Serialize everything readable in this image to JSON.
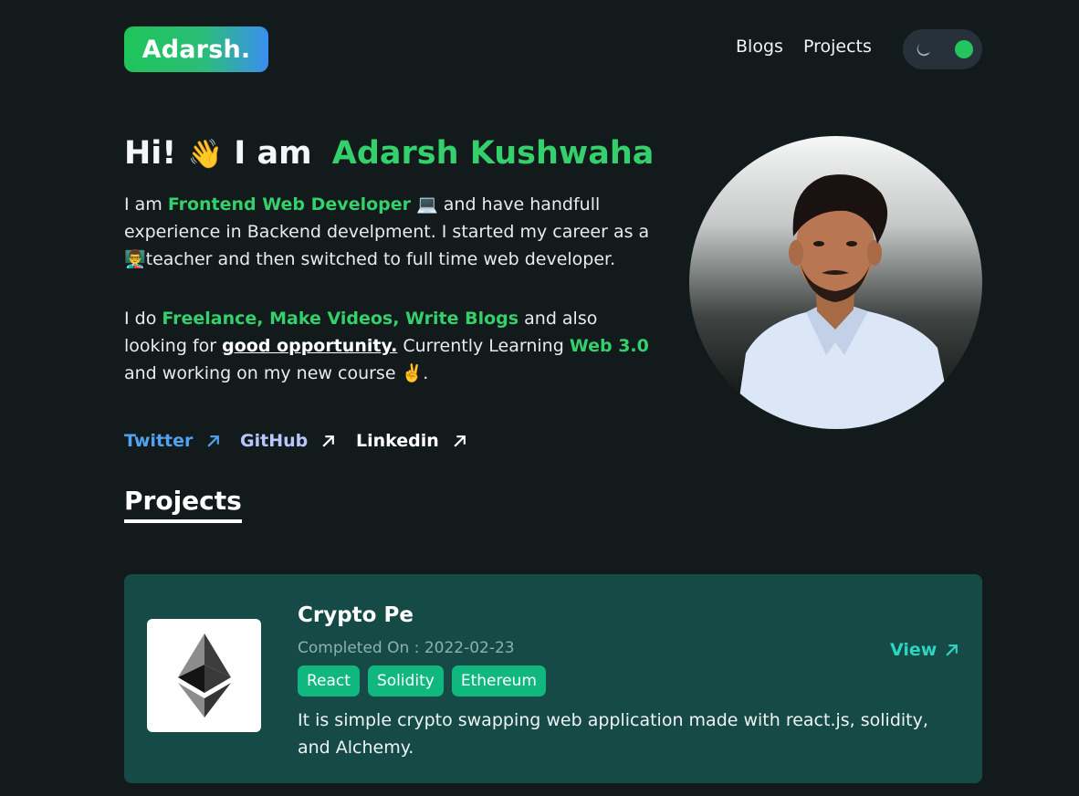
{
  "header": {
    "logo": "Adarsh.",
    "nav": {
      "blogs": "Blogs",
      "projects": "Projects"
    },
    "theme_toggle": {
      "icon": "moon-icon",
      "state_color": "#22c55e"
    }
  },
  "hero": {
    "greeting": "Hi!",
    "wave_emoji": "👋",
    "i_am": "I am",
    "name": "Adarsh Kushwaha",
    "bio1": {
      "p1": "I am ",
      "role": "Frontend Web Developer",
      "laptop": " 💻 ",
      "p2": " and have handfull experience in Backend develpment. I started my career as a ",
      "teacher": "👨‍🏫",
      "p3": "teacher and then switched to full time web developer."
    },
    "bio2": {
      "p1": "I do ",
      "activities": "Freelance, Make Videos, Write Blogs",
      "p2": " and also looking for ",
      "opportunity": "good opportunity.",
      "p3": " Currently Learning ",
      "learning": "Web 3.0",
      "p4": " and working on my new course ",
      "victory": "✌️",
      "p5": "."
    }
  },
  "social": {
    "twitter": "Twitter",
    "github": "GitHub",
    "linkedin": "Linkedin"
  },
  "projects_section": {
    "title": "Projects",
    "items": [
      {
        "title": "Crypto Pe",
        "completed": "Completed On : 2022-02-23",
        "tags": [
          "React",
          "Solidity",
          "Ethereum"
        ],
        "view": "View",
        "description": "It is simple crypto swapping web application made with react.js, solidity, and Alchemy."
      }
    ]
  },
  "colors": {
    "background": "#121a1b",
    "accent_green": "#34d06b",
    "card": "#154a47",
    "tag": "#10b77f",
    "view_link": "#2dd4bf"
  }
}
